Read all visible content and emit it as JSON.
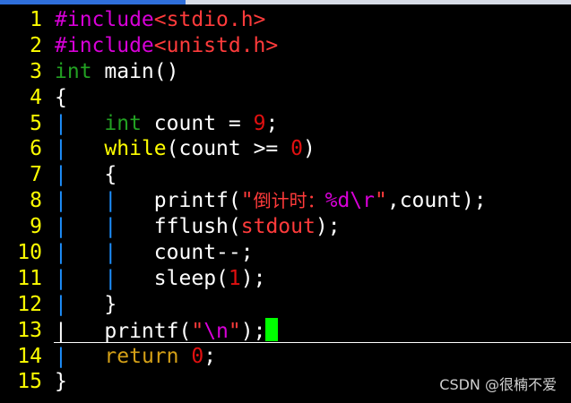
{
  "lines": [
    {
      "n": "1",
      "parts": [
        [
          "kw-pre",
          "#include"
        ],
        [
          "hdr",
          "<stdio.h>"
        ]
      ]
    },
    {
      "n": "2",
      "parts": [
        [
          "kw-pre",
          "#include"
        ],
        [
          "hdr",
          "<unistd.h>"
        ]
      ]
    },
    {
      "n": "3",
      "parts": [
        [
          "type",
          "int"
        ],
        [
          "plain",
          " main()"
        ]
      ]
    },
    {
      "n": "4",
      "parts": [
        [
          "plain",
          "{"
        ]
      ]
    },
    {
      "n": "5",
      "parts": [
        [
          "indent-bar",
          "|"
        ],
        [
          "plain",
          "   "
        ],
        [
          "type",
          "int"
        ],
        [
          "plain",
          " count = "
        ],
        [
          "num",
          "9"
        ],
        [
          "plain",
          ";"
        ]
      ]
    },
    {
      "n": "6",
      "parts": [
        [
          "indent-bar",
          "|"
        ],
        [
          "plain",
          "   "
        ],
        [
          "ctrl",
          "while"
        ],
        [
          "plain",
          "(count >= "
        ],
        [
          "num",
          "0"
        ],
        [
          "plain",
          ")"
        ]
      ]
    },
    {
      "n": "7",
      "parts": [
        [
          "indent-bar",
          "|"
        ],
        [
          "plain",
          "   {"
        ]
      ]
    },
    {
      "n": "8",
      "parts": [
        [
          "indent-bar",
          "|"
        ],
        [
          "plain",
          "   "
        ],
        [
          "indent-bar",
          "|"
        ],
        [
          "plain",
          "   printf("
        ],
        [
          "str",
          "\""
        ],
        [
          "cjk",
          "倒计时："
        ],
        [
          "fmt",
          "%d\\r"
        ],
        [
          "str",
          "\""
        ],
        [
          "plain",
          ",count);"
        ]
      ]
    },
    {
      "n": "9",
      "parts": [
        [
          "indent-bar",
          "|"
        ],
        [
          "plain",
          "   "
        ],
        [
          "indent-bar",
          "|"
        ],
        [
          "plain",
          "   fflush("
        ],
        [
          "str",
          "stdout"
        ],
        [
          "plain",
          ");"
        ]
      ]
    },
    {
      "n": "10",
      "parts": [
        [
          "indent-bar",
          "|"
        ],
        [
          "plain",
          "   "
        ],
        [
          "indent-bar",
          "|"
        ],
        [
          "plain",
          "   count--;"
        ]
      ]
    },
    {
      "n": "11",
      "parts": [
        [
          "indent-bar",
          "|"
        ],
        [
          "plain",
          "   "
        ],
        [
          "indent-bar",
          "|"
        ],
        [
          "plain",
          "   sleep("
        ],
        [
          "num",
          "1"
        ],
        [
          "plain",
          ");"
        ]
      ]
    },
    {
      "n": "12",
      "parts": [
        [
          "indent-bar",
          "|"
        ],
        [
          "plain",
          "   }"
        ]
      ]
    },
    {
      "n": "13",
      "parts": [
        [
          "plain",
          "|   printf("
        ],
        [
          "str",
          "\""
        ],
        [
          "fmt",
          "\\n"
        ],
        [
          "str",
          "\""
        ],
        [
          "plain",
          ");"
        ],
        [
          "cursor",
          ""
        ]
      ]
    },
    {
      "n": "14",
      "parts": [
        [
          "indent-bar",
          "|"
        ],
        [
          "plain",
          "   "
        ],
        [
          "stmt",
          "return"
        ],
        [
          "plain",
          " "
        ],
        [
          "num",
          "0"
        ],
        [
          "plain",
          ";"
        ]
      ]
    },
    {
      "n": "15",
      "parts": [
        [
          "plain",
          "}"
        ]
      ]
    }
  ],
  "watermark": "CSDN @很楠不爱"
}
